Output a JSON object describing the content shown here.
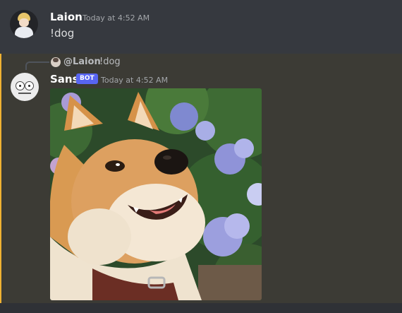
{
  "messages": [
    {
      "author": "Laion",
      "timestamp": "Today at 4:52 AM",
      "content": "!dog"
    },
    {
      "reply": {
        "author": "@Laion",
        "content": "!dog"
      },
      "author": "Sans",
      "badge": "BOT",
      "timestamp": "Today at 4:52 AM",
      "attachment": {
        "type": "image",
        "subject": "shiba-inu-dog-with-hydrangeas"
      }
    }
  ],
  "colors": {
    "background": "#36393f",
    "highlight_background": "#3c3b35",
    "mention_bar": "#f0b232",
    "bot_badge": "#5865f2",
    "username": "#ffffff",
    "timestamp": "#a3a6aa"
  }
}
